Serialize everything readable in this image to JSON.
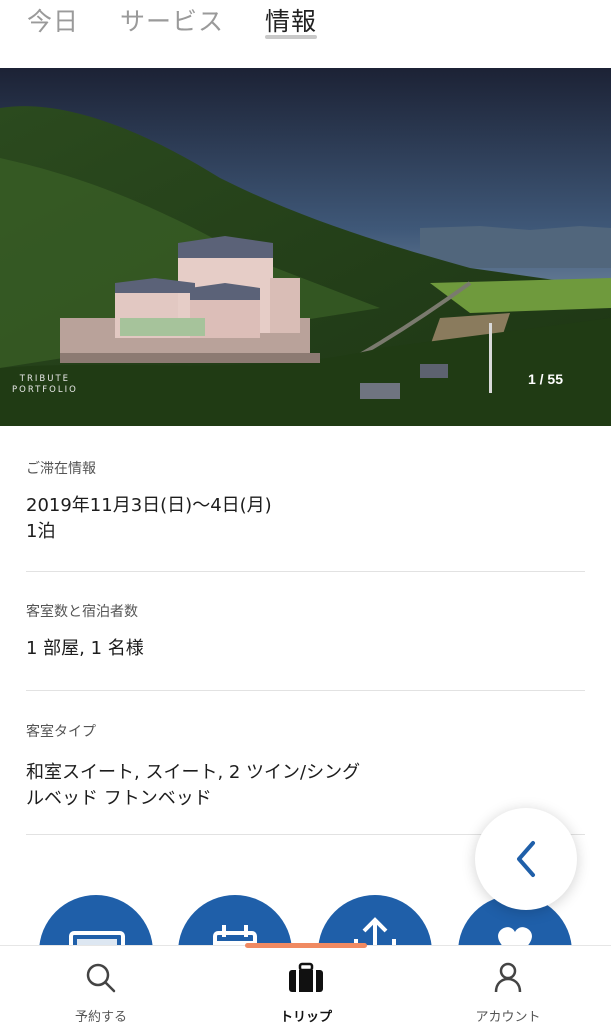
{
  "top_tabs": [
    {
      "label": "今日"
    },
    {
      "label": "サービス"
    },
    {
      "label": "情報"
    }
  ],
  "hero": {
    "brand_line1": "TRIBUTE",
    "brand_line2": "PORTFOLIO",
    "counter": "1 / 55"
  },
  "stay": {
    "label": "ご滞在情報",
    "dates": "2019年11月3日(日)〜4日(月)",
    "nights": "1泊"
  },
  "rooms": {
    "label": "客室数と宿泊者数",
    "value": "1 部屋, 1 名様"
  },
  "room_type": {
    "label": "客室タイプ",
    "line1": "和室スイート, スイート, 2 ツイン/シング",
    "line2": "ルベッド フトンベッド"
  },
  "bottom_nav": [
    {
      "label": "予約する",
      "icon": "search-icon"
    },
    {
      "label": "トリップ",
      "icon": "suitcase-icon"
    },
    {
      "label": "アカウント",
      "icon": "person-icon"
    }
  ],
  "colors": {
    "accent_blue": "#1f5fa9",
    "nav_indicator": "#f08a62"
  }
}
